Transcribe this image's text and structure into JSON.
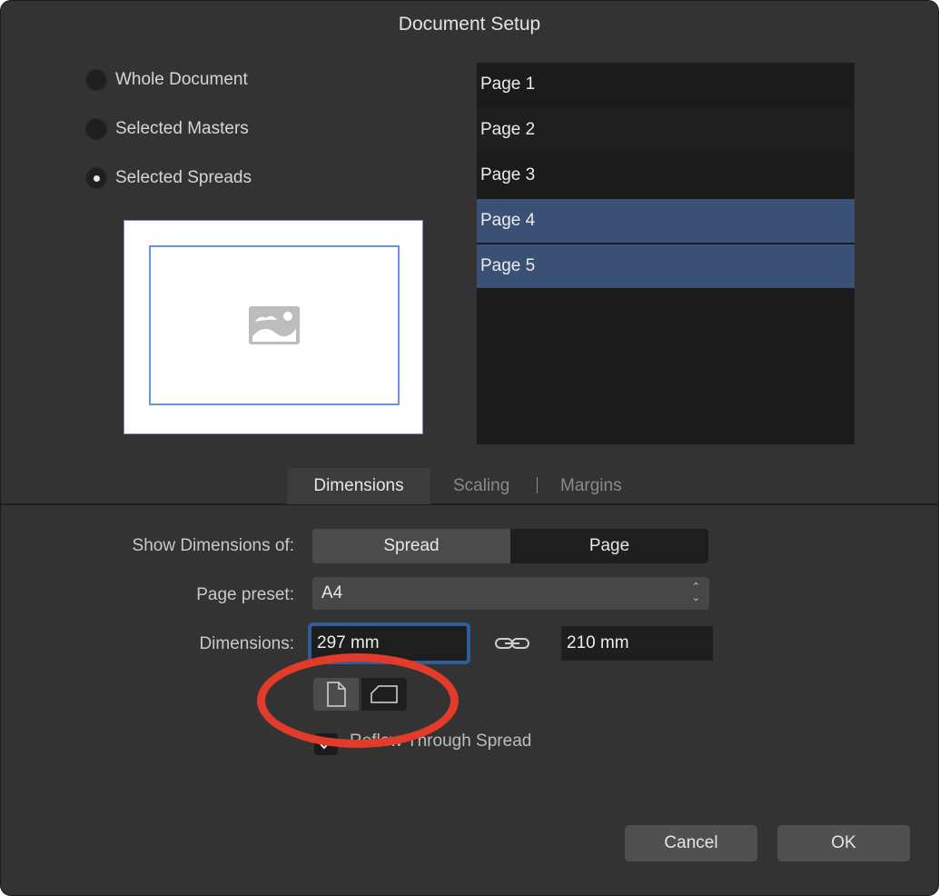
{
  "window": {
    "title": "Document Setup"
  },
  "scope": {
    "options": [
      {
        "label": "Whole Document",
        "selected": false
      },
      {
        "label": "Selected Masters",
        "selected": false
      },
      {
        "label": "Selected Spreads",
        "selected": true
      }
    ]
  },
  "pages": [
    {
      "label": "Page 1",
      "selected": false
    },
    {
      "label": "Page 2",
      "selected": false
    },
    {
      "label": "Page 3",
      "selected": false
    },
    {
      "label": "Page 4",
      "selected": true
    },
    {
      "label": "Page 5",
      "selected": true
    }
  ],
  "tabs": [
    {
      "label": "Dimensions",
      "active": true
    },
    {
      "label": "Scaling",
      "active": false
    },
    {
      "label": "Margins",
      "active": false
    }
  ],
  "form": {
    "show_dimensions_label": "Show Dimensions of:",
    "show_dimensions_options": [
      "Spread",
      "Page"
    ],
    "show_dimensions_selected": "Spread",
    "page_preset_label": "Page preset:",
    "page_preset_value": "A4",
    "dimensions_label": "Dimensions:",
    "width_value": "297 mm",
    "height_value": "210 mm",
    "orientation_selected": "portrait",
    "reflow_label": "Reflow Through Spread",
    "reflow_checked": true
  },
  "buttons": {
    "cancel": "Cancel",
    "ok": "OK"
  },
  "colors": {
    "dialog_bg": "#333333",
    "list_bg": "#1b1b1b",
    "selection": "#3a5075",
    "focus_ring": "#2f5d9a",
    "annotation": "#e23b2a"
  },
  "icons": {
    "preview_placeholder": "image-placeholder-icon",
    "link": "chain-link-icon",
    "portrait": "portrait-page-icon",
    "landscape": "landscape-page-icon",
    "checkmark": "checkmark-icon"
  }
}
